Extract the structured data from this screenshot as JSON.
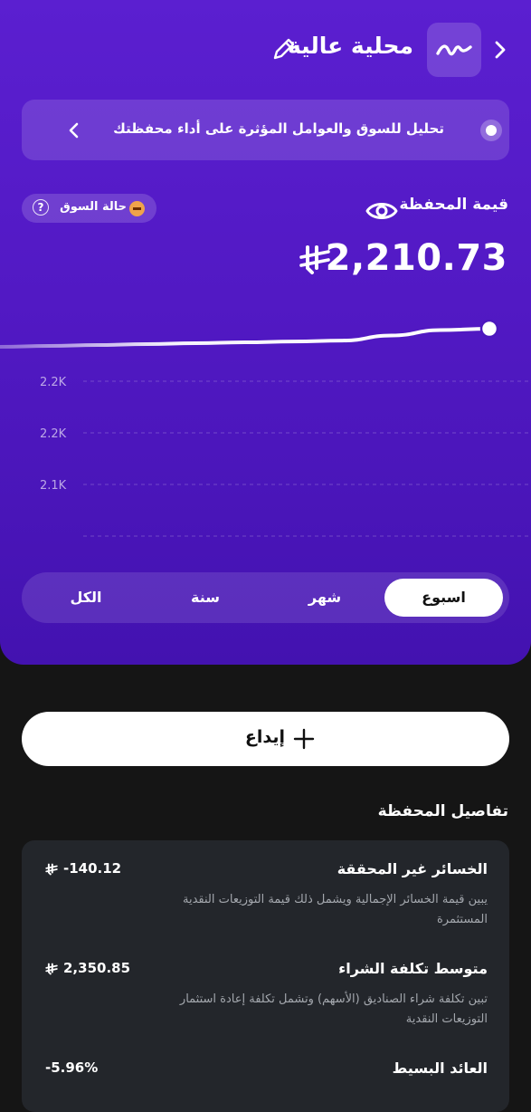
{
  "header": {
    "title": "محلية عالية",
    "icons": {
      "back": "chevron-right-icon",
      "logo": "wave-logo-icon",
      "edit": "pencil-icon"
    }
  },
  "insight": {
    "text": "تحليل للسوق والعوامل المؤثرة على أداء محفظتك",
    "icon": "chevron-left-icon"
  },
  "portfolio": {
    "label": "قيمة المحفظة",
    "value": "2,210.73",
    "currency_icon": "saudi-riyal-icon",
    "eye_icon": "eye-icon"
  },
  "market_status": {
    "label": "حالة السوق",
    "help_symbol": "?",
    "status_color": "#f0a34a"
  },
  "chart": {
    "y_ticks": [
      "2.2K",
      "2.2K",
      "2.1K"
    ]
  },
  "chart_data": {
    "type": "line",
    "x": [
      0,
      1,
      2,
      3,
      4,
      5,
      6,
      7,
      8,
      9,
      10
    ],
    "values": [
      2150,
      2153,
      2156,
      2159,
      2162,
      2165,
      2168,
      2171,
      2188,
      2206,
      2210.73
    ],
    "ytick_labels": [
      "2.2K",
      "2.2K",
      "2.1K"
    ],
    "grid": true
  },
  "range_tabs": [
    {
      "label": "اسبوع",
      "active": true
    },
    {
      "label": "شهر",
      "active": false
    },
    {
      "label": "سنة",
      "active": false
    },
    {
      "label": "الكل",
      "active": false
    }
  ],
  "deposit": {
    "label": "إيداع",
    "icon": "plus-icon"
  },
  "details": {
    "section_title": "تفاصيل المحفظة",
    "items": [
      {
        "title": "الخسائر غير المحققة",
        "value": "-140.12",
        "desc": "يبين قيمة الخسائر الإجمالية ويشمل ذلك قيمة التوزيعات النقدية المستثمرة"
      },
      {
        "title": "متوسط تكلفة الشراء",
        "value": "2,350.85",
        "desc": "تبين تكلفة شراء الصناديق (الأسهم) وتشمل تكلفة إعادة استثمار التوزيعات النقدية"
      },
      {
        "title": "العائد البسيط",
        "value": "-5.96%",
        "desc": ""
      }
    ]
  },
  "colors": {
    "hero_gradient_start": "#5b1fd0",
    "hero_gradient_end": "#4312b0",
    "page_background": "#151515",
    "card_background": "#23262b",
    "market_status": "#f0a34a"
  }
}
